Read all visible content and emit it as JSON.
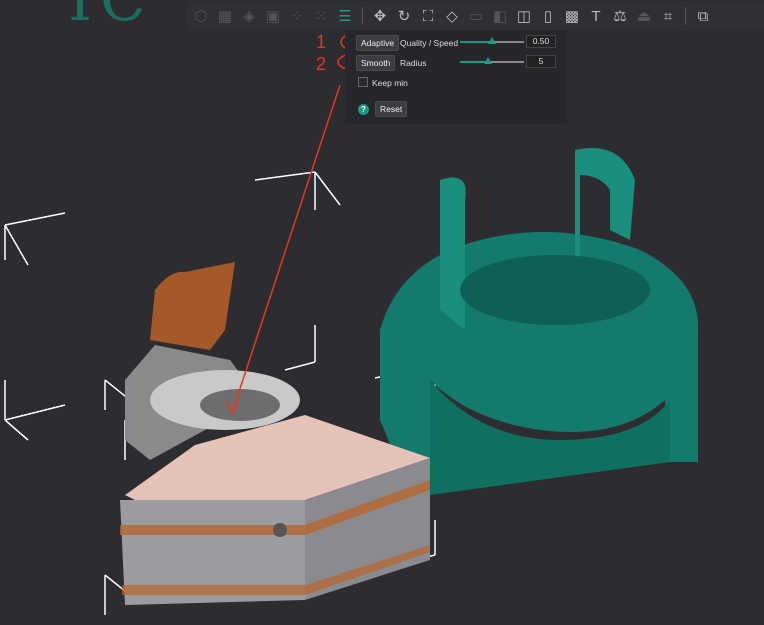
{
  "toolbar": {
    "icons": [
      "cube-icon",
      "grid-icon",
      "arrange-icon",
      "layers-plate-icon",
      "split-icon",
      "split-parts-icon",
      "variable-layer-height-icon",
      "move-icon",
      "rotate-icon",
      "scale-icon",
      "lay-on-face-icon",
      "cut-icon",
      "mesh-boolean-icon",
      "support-paint-icon",
      "seam-paint-icon",
      "fuzzy-skin-icon",
      "text-icon",
      "measure-icon",
      "color-paint-icon",
      "assembly-icon",
      "puzzle-icon"
    ]
  },
  "panel": {
    "adaptive_label": "Adaptive",
    "quality_label": "Quality / Speed",
    "quality_value": "0.50",
    "quality_fraction": 0.5,
    "smooth_label": "Smooth",
    "radius_label": "Radius",
    "radius_value": "5",
    "radius_fraction": 0.44,
    "keep_min_label": "Keep min",
    "keep_min_checked": false,
    "help_label": "?",
    "reset_label": "Reset"
  },
  "annotations": {
    "step1": "1",
    "step2": "2"
  },
  "colors": {
    "accent": "#1b9a86",
    "annotation": "#e03a1e",
    "model_teal": "#147a6b"
  }
}
